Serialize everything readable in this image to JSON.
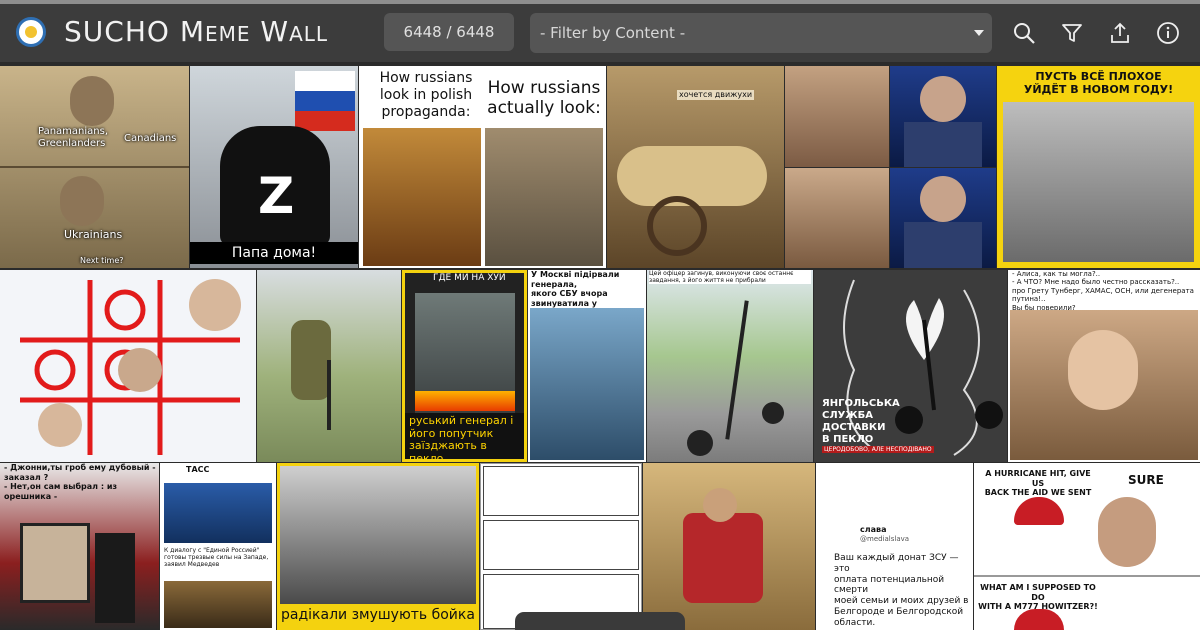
{
  "header": {
    "title": "SUCHO Meme Wall",
    "counter": "6448 / 6448",
    "filter_placeholder": "- Filter by Content -",
    "icons": [
      "search-icon",
      "filter-icon",
      "share-icon",
      "info-icon"
    ]
  },
  "memes": {
    "m1": {
      "label1": "Panamanians,\nGreenlanders",
      "label2": "Canadians",
      "label3": "Ukrainians",
      "label4": "Next time?"
    },
    "m2": {
      "caption": "Папа дома!",
      "letter": "Z"
    },
    "m3": {
      "left": "How russians\nlook in polish\npropaganda:",
      "right": "How russians\nactually look:"
    },
    "m4": {
      "caption": "хочется движухи"
    },
    "m7": {
      "caption": "ПУСТЬ ВСЁ ПЛОХОЕ\nУЙДЁТ В НОВОМ ГОДУ!"
    },
    "m10": {
      "top": "ГДЕ МИ НА ХУЙ",
      "bottom": "руський генерал і його\nпопутчик заїзджають\nв пекло"
    },
    "m11": {
      "caption": "У Москві підірвали генерала,\nякого СБУ вчора\nзвинуватила у застосуванні\nхімзброї проти ЗСУ"
    },
    "m12": {
      "caption": "Цей офіцер загинув, виконуючи своє останнє завдання, з його життя не прибрали"
    },
    "m13": {
      "caption": "ЯНГОЛЬСЬКА\nСЛУЖБА\nДОСТАВКИ\nВ ПЕКЛО",
      "sub": "ЦЕРОДОБОВО, АЛЕ НЕСПОДІВАНО"
    },
    "m14": {
      "caption": "- Алиса, как ты могла?..\n- А ЧТО? Мне надо было честно рассказать?..\nпро Грету Тунберг, ХАМАС, ОСН, или дегенерата путина!..\nВы бы поверили?"
    },
    "m15": {
      "caption": "- Джонни,ты гроб ему дубовый -\nзаказал ?\n- Нет,он сам выбрал : из\nорешника -"
    },
    "m16": {
      "source": "ТАСС",
      "caption": "К диалогу с \"Единой Россией\"\nготовы трезвые силы на Западе,\nзаявил Медведев"
    },
    "m17": {
      "caption": "радікали змушують бойка"
    },
    "m19": {
      "name": "слава",
      "handle": "@medialslava",
      "caption": "Ваш каждый донат ЗСУ — это\nоплата потенциальной смерти\nмоей семьи и моих друзей в\nБелгороде и Белгородской\nобласти."
    },
    "m20": {
      "top": "A HURRICANE HIT, GIVE US\nBACK THE AID WE SENT",
      "right": "SURE",
      "bottom": "WHAT AM I SUPPOSED TO DO\nWITH A M777 HOWITZER?!"
    }
  },
  "colors": {
    "header_bg": "#3c3c3c",
    "accent_yellow": "#ffd400",
    "tile_bg": "#cfcfcf"
  }
}
